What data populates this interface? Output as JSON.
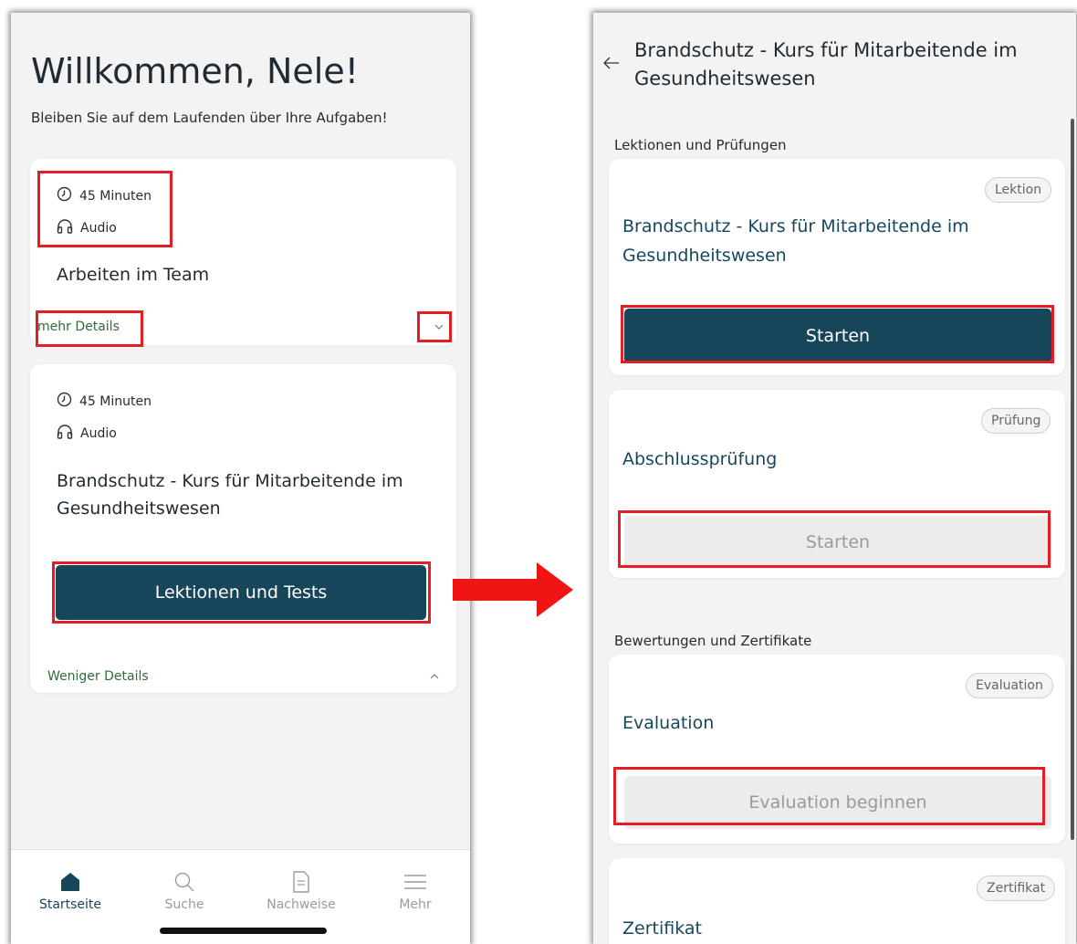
{
  "left": {
    "welcome_title": "Willkommen, Nele!",
    "welcome_subtitle": "Bleiben Sie auf dem Laufenden über Ihre Aufgaben!",
    "card1": {
      "duration": "45 Minuten",
      "format": "Audio",
      "title": "Arbeiten im Team",
      "details_link": "mehr Details"
    },
    "card2": {
      "duration": "45 Minuten",
      "format": "Audio",
      "title_line1": "Brandschutz - Kurs für Mitarbeitende im",
      "title_line2": "Gesundheitswesen",
      "button": "Lektionen und Tests",
      "details_link": "Weniger Details"
    },
    "nav": [
      {
        "label": "Startseite",
        "icon": "home-icon",
        "active": true
      },
      {
        "label": "Suche",
        "icon": "search-icon",
        "active": false
      },
      {
        "label": "Nachweise",
        "icon": "document-icon",
        "active": false
      },
      {
        "label": "Mehr",
        "icon": "menu-icon",
        "active": false
      }
    ]
  },
  "right": {
    "header_line1": "Brandschutz - Kurs für Mitarbeitende im",
    "header_line2": "Gesundheitswesen",
    "section1": "Lektionen und Prüfungen",
    "section2": "Bewertungen und Zertifikate",
    "cards": [
      {
        "badge": "Lektion",
        "title_line1": "Brandschutz - Kurs für Mitarbeitende im",
        "title_line2": "Gesundheitswesen",
        "button": "Starten"
      },
      {
        "badge": "Prüfung",
        "title": "Abschlussprüfung",
        "button": "Starten"
      },
      {
        "badge": "Evaluation",
        "title": "Evaluation",
        "button": "Evaluation beginnen"
      },
      {
        "badge": "Zertifikat",
        "title": "Zertifikat"
      }
    ]
  },
  "colors": {
    "accent_dark": "#17465b",
    "link_green": "#2e6b3a",
    "highlight_red": "#e31e24",
    "arrow_red": "#f01414"
  }
}
